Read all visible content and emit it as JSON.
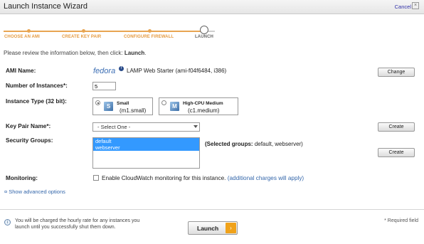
{
  "window": {
    "title": "Launch Instance Wizard",
    "cancel_label": "Cancel",
    "close_icon": "×"
  },
  "steps": [
    {
      "label": "CHOOSE AN AMI"
    },
    {
      "label": "CREATE KEY PAIR"
    },
    {
      "label": "CONFIGURE FIREWALL"
    },
    {
      "label": "LAUNCH"
    }
  ],
  "intro": {
    "prefix": "Please review the information below, then click: ",
    "action": "Launch",
    "suffix": "."
  },
  "ami": {
    "label": "AMI Name:",
    "logo_text": "fedora",
    "value": "LAMP Web Starter (ami-f04f6484, i386)",
    "change_label": "Change"
  },
  "instances": {
    "label": "Number of Instances*:",
    "value": "5"
  },
  "instance_type": {
    "label": "Instance Type (32 bit):",
    "options": [
      {
        "name": "Small",
        "code": "(m1.small)",
        "selected": true,
        "icon": "S"
      },
      {
        "name": "High-CPU Medium",
        "code": "(c1.medium)",
        "selected": false,
        "icon": "M"
      }
    ]
  },
  "key_pair": {
    "label": "Key Pair Name*:",
    "selected": "- Select One -",
    "create_label": "Create"
  },
  "security_groups": {
    "label": "Security Groups:",
    "items": [
      "default",
      "webserver"
    ],
    "selected_label": "(Selected groups:",
    "selected_values": "default, webserver)",
    "create_label": "Create"
  },
  "monitoring": {
    "label": "Monitoring:",
    "checkbox_label": "Enable CloudWatch monitoring for this instance.",
    "link": "(additional charges will apply)"
  },
  "advanced": {
    "label": "¤ Show advanced options"
  },
  "footer": {
    "note": "You will be charged the hourly rate for any instances you launch until you successfully shut them down.",
    "launch_label": "Launch",
    "launch_arrow": "›",
    "required_note": "* Required field"
  },
  "colors": {
    "accent": "#e8a552",
    "link": "#3366aa",
    "selection": "#3399ff",
    "launch_arrow": "#f0a21a"
  }
}
